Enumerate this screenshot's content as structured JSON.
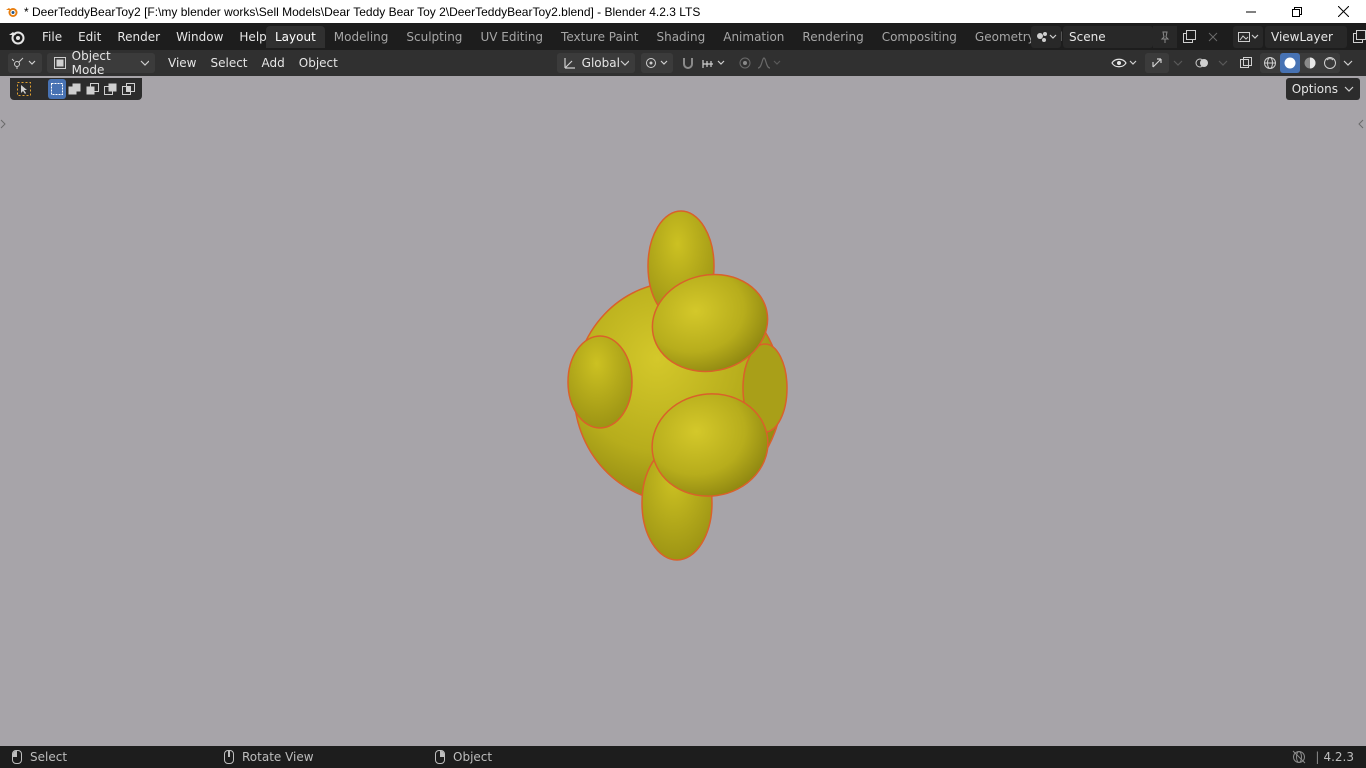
{
  "window": {
    "title": "* DeerTeddyBearToy2 [F:\\my blender works\\Sell Models\\Dear Teddy Bear Toy 2\\DeerTeddyBearToy2.blend] - Blender 4.2.3 LTS",
    "minimize_icon": "minimize-icon",
    "restore_icon": "restore-icon",
    "close_icon": "close-icon"
  },
  "menu": {
    "items": [
      "File",
      "Edit",
      "Render",
      "Window",
      "Help"
    ]
  },
  "workspaces": {
    "tabs": [
      "Layout",
      "Modeling",
      "Sculpting",
      "UV Editing",
      "Texture Paint",
      "Shading",
      "Animation",
      "Rendering",
      "Compositing",
      "Geometry Nodes"
    ],
    "active": "Layout"
  },
  "scene": {
    "name": "Scene"
  },
  "view_layer": {
    "name": "ViewLayer"
  },
  "viewport_header": {
    "mode": "Object Mode",
    "menus": [
      "View",
      "Select",
      "Add",
      "Object"
    ],
    "orientation": "Global"
  },
  "viewport": {
    "options_label": "Options",
    "background_color": "#a7a4a9",
    "object_color": "#b8ae1c",
    "outline_color": "#d9612a"
  },
  "statusbar": {
    "select": "Select",
    "rotate": "Rotate View",
    "object": "Object",
    "version": "4.2.3"
  }
}
